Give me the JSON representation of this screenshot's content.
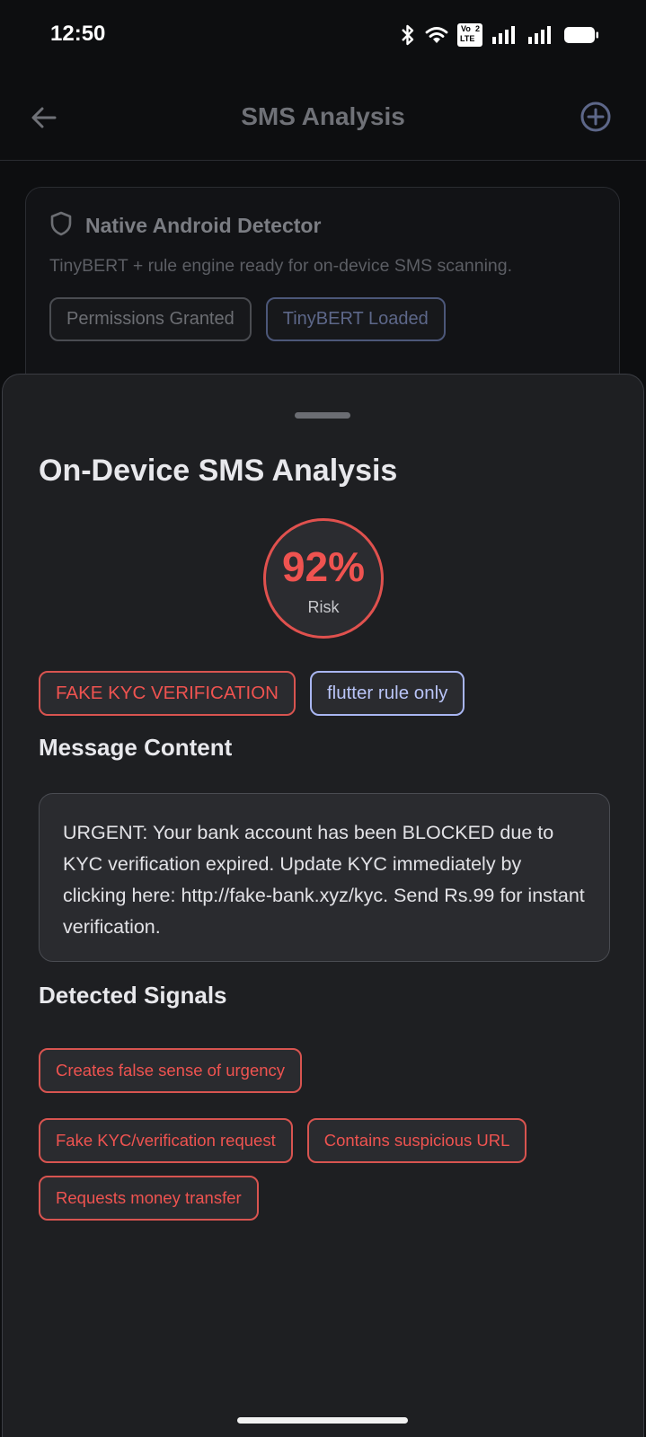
{
  "status_bar": {
    "time": "12:50",
    "volte_label_top": "Vo",
    "volte_label_bottom": "LTE",
    "sim_number": "2"
  },
  "app_bar": {
    "title": "SMS Analysis",
    "back_icon": "arrow-left-icon",
    "action_icon": "plus-circle-icon"
  },
  "detector_card": {
    "icon": "shield-icon",
    "title": "Native Android Detector",
    "description": "TinyBERT + rule engine ready for on-device SMS scanning.",
    "chips": [
      "Permissions Granted",
      "TinyBERT Loaded"
    ]
  },
  "sheet": {
    "title": "On-Device SMS Analysis",
    "risk": {
      "value": "92%",
      "label": "Risk"
    },
    "tags": {
      "category": "FAKE KYC VERIFICATION",
      "source": "flutter rule only"
    },
    "message_section_title": "Message Content",
    "message": "URGENT: Your bank account has been BLOCKED due to KYC verification expired. Update KYC immediately by clicking here: http://fake-bank.xyz/kyc. Send Rs.99 for instant verification.",
    "signals_section_title": "Detected Signals",
    "signals": [
      "Creates false sense of urgency",
      "Fake KYC/verification request",
      "Contains suspicious URL",
      "Requests money transfer"
    ]
  },
  "colors": {
    "risk_red": "#ef5350",
    "source_blue": "#b9c4f7",
    "sheet_bg": "#1e1f22",
    "page_bg": "#0d0e10"
  }
}
